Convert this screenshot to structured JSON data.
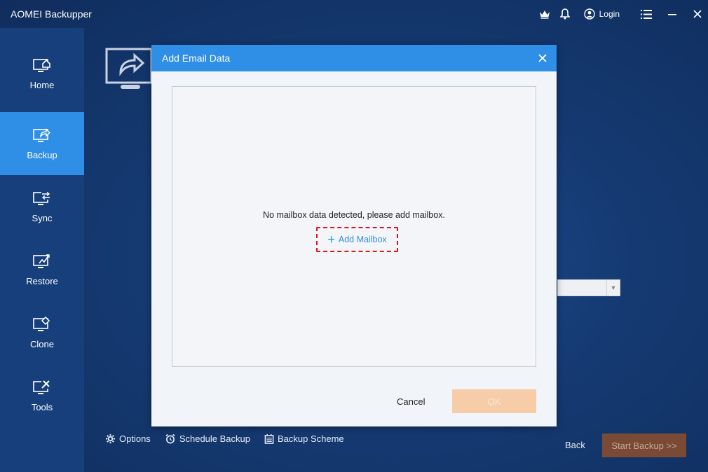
{
  "app": {
    "title": "AOMEI Backupper"
  },
  "titlebar": {
    "login_label": "Login"
  },
  "sidebar": {
    "items": [
      {
        "label": "Home"
      },
      {
        "label": "Backup"
      },
      {
        "label": "Sync"
      },
      {
        "label": "Restore"
      },
      {
        "label": "Clone"
      },
      {
        "label": "Tools"
      }
    ],
    "active": "Backup"
  },
  "bottombar": {
    "options_label": "Options",
    "schedule_label": "Schedule Backup",
    "scheme_label": "Backup Scheme",
    "back_label": "Back",
    "start_label": "Start Backup >>"
  },
  "dialog": {
    "title": "Add Email Data",
    "empty_message": "No mailbox data detected, please add mailbox.",
    "add_mailbox_label": "Add Mailbox",
    "cancel_label": "Cancel",
    "ok_label": "OK"
  },
  "colors": {
    "accent": "#2f8ee5",
    "background": "#153a72",
    "sidebar": "#173f7c",
    "highlight_border": "#e0141e",
    "ok_disabled": "#f6cca9",
    "start_disabled": "#7a4a34"
  }
}
